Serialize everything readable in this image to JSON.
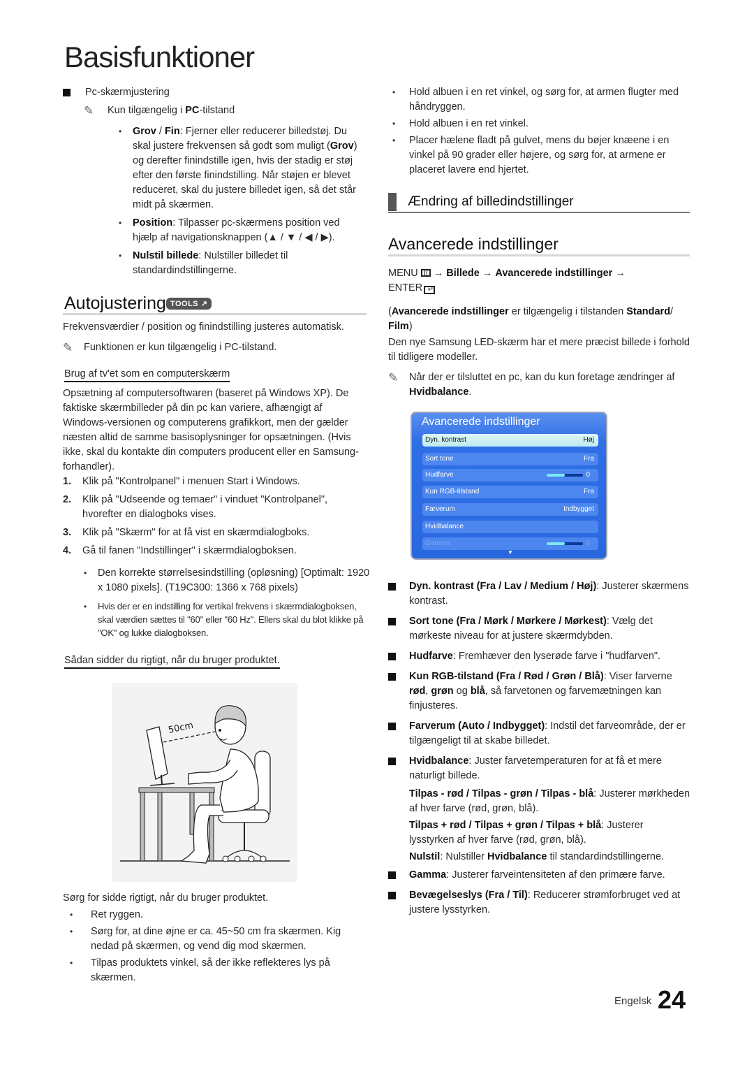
{
  "page": {
    "title": "Basisfunktioner",
    "language": "Engelsk",
    "page_number": "24"
  },
  "left": {
    "pc_adjust": {
      "heading": "Pc-skærmjustering",
      "note_prefix": "Kun tilgængelig i ",
      "note_bold": "PC",
      "note_suffix": "-tilstand",
      "bullets": [
        {
          "bold": "Grov",
          "sep": " / ",
          "bold2": "Fin",
          "text": ": Fjerner eller reducerer billedstøj. Du skal justere frekvensen så godt som muligt (",
          "bold3": "Grov",
          "text2": ") og derefter finindstille igen, hvis der stadig er støj efter den første finindstilling. Når støjen er blevet reduceret, skal du justere billedet igen, så det står midt på skærmen."
        },
        {
          "bold": "Position",
          "text": ": Tilpasser pc-skærmens position ved hjælp af navigationsknappen (▲ / ▼ / ◀ / ▶)."
        },
        {
          "bold": "Nulstil billede",
          "text": ": Nulstiller billedet til standardindstillingerne."
        }
      ]
    },
    "autojust": {
      "heading": "Autojustering",
      "badge": "TOOLS",
      "badge_icon": "↗",
      "desc": "Frekvensværdier / position og finindstilling justeres automatisk.",
      "note": "Funktionen er kun tilgængelig i PC-tilstand."
    },
    "computer": {
      "subheading": "Brug af tv'et som en computerskærm",
      "intro": "Opsætning af computersoftwaren (baseret på Windows XP). De faktiske skærmbilleder på din pc kan variere, afhængigt af Windows-versionen og computerens grafikkort, men der gælder næsten altid de samme basisoplysninger for opsætningen. (Hvis ikke, skal du kontakte din computers producent eller en Samsung-forhandler).",
      "steps": [
        {
          "num": "1.",
          "text": "Klik på \"Kontrolpanel\" i menuen Start i Windows."
        },
        {
          "num": "2.",
          "text": "Klik på \"Udseende og temaer\" i vinduet \"Kontrolpanel\", hvorefter en dialogboks vises."
        },
        {
          "num": "3.",
          "text": "Klik på \"Skærm\" for at få vist en skærmdialogboks."
        },
        {
          "num": "4.",
          "text": "Gå til fanen \"Indstillinger\" i skærmdialogboksen."
        }
      ],
      "sub_bullets": [
        "Den korrekte størrelsesindstilling (opløsning) [Optimalt: 1920 x 1080 pixels]. (T19C300: 1366 x 768 pixels)",
        "Hvis der er en indstilling for vertikal frekvens i skærmdialogboksen, skal værdien sættes til \"60\" eller \"60 Hz\". Ellers skal du blot klikke på \"OK\" og lukke dialogboksen."
      ]
    },
    "posture": {
      "subheading": "Sådan sidder du rigtigt, når du bruger produktet.",
      "illus_label": "50cm",
      "intro": "Sørg for sidde rigtigt, når du bruger produktet.",
      "bullets": [
        "Ret ryggen.",
        "Sørg for, at dine øjne er ca. 45~50 cm fra skærmen. Kig nedad på skærmen, og vend dig mod skærmen.",
        "Tilpas produktets vinkel, så der ikke reflekteres lys på skærmen."
      ]
    }
  },
  "right": {
    "posture_bullets": [
      "Hold albuen i en ret vinkel, og sørg for, at armen flugter med håndryggen.",
      "Hold albuen i en ret vinkel.",
      "Placer hælene fladt på gulvet, mens du bøjer knæene i en vinkel på 90 grader eller højere, og sørg for, at armene er placeret lavere end hjertet."
    ],
    "section_heading": "Ændring af billedindstillinger",
    "advanced": {
      "heading": "Avancerede indstillinger",
      "menu_path": {
        "menu": "MENU",
        "arrow": "→",
        "p1": "Billede",
        "p2": "Avancerede indstillinger",
        "enter": "ENTER"
      },
      "avail_bold": "Avancerede indstillinger",
      "avail_text": " er tilgængelig i tilstanden ",
      "avail_bold2": "Standard",
      "avail_sep": "/ ",
      "avail_bold3": "Film",
      "desc": "Den nye Samsung LED-skærm har et mere præcist billede i forhold til tidligere modeller.",
      "note_prefix": "Når der er tilsluttet en pc, kan du kun foretage ændringer af ",
      "note_bold": "Hvidbalance",
      "note_suffix": "."
    },
    "osd": {
      "title": "Avancerede indstillinger",
      "rows": [
        {
          "label": "Dyn. kontrast",
          "value": "Høj",
          "selected": true
        },
        {
          "label": "Sort tone",
          "value": "Fra"
        },
        {
          "label": "Hudfarve",
          "value": "0",
          "slider": 0.5
        },
        {
          "label": "Kun RGB-tilstand",
          "value": "Fra"
        },
        {
          "label": "Farverum",
          "value": "Indbygget"
        },
        {
          "label": "Hvidbalance",
          "value": ""
        },
        {
          "label": "Gamma",
          "value": "0",
          "slider": 0.5,
          "disabled": true
        }
      ],
      "more_arrow": "▼"
    },
    "items": [
      {
        "bold": "Dyn. kontrast (Fra / Lav / Medium / Høj)",
        "text": ": Justerer skærmens kontrast."
      },
      {
        "bold": "Sort tone (Fra / Mørk / Mørkere / Mørkest)",
        "text": ": Vælg det mørkeste niveau for at justere skærmdybden."
      },
      {
        "bold": "Hudfarve",
        "text": ": Fremhæver den lyserøde farve i \"hudfarven\"."
      },
      {
        "bold": "Kun RGB-tilstand (Fra / Rød / Grøn / Blå)",
        "text": ": Viser farverne ",
        "bold2": "rød",
        "t2": ", ",
        "bold3": "grøn",
        "t3": " og ",
        "bold4": "blå",
        "t4": ", så farvetonen og farvemætningen kan finjusteres."
      },
      {
        "bold": "Farverum (Auto / Indbygget)",
        "text": ": Indstil det farveområde, der er tilgængeligt til at skabe billedet."
      },
      {
        "bold": "Hvidbalance",
        "text": ": Juster farvetemperaturen for at få et mere naturligt billede."
      },
      {
        "bold": "Gamma",
        "text": ": Justerer farveintensiteten af den primære farve."
      },
      {
        "bold": "Bevægelseslys (Fra / Til)",
        "text": ": Reducerer strømforbruget ved at justere lysstyrken."
      }
    ],
    "whitebalance_sub": [
      {
        "bold": "Tilpas - rød / Tilpas - grøn / Tilpas - blå",
        "text": ": Justerer mørkheden af hver farve (rød, grøn, blå)."
      },
      {
        "bold": "Tilpas + rød / Tilpas + grøn / Tilpas + blå",
        "text": ": Justerer lysstyrken af hver farve (rød, grøn, blå)."
      },
      {
        "bold": "Nulstil",
        "text": ": Nulstiller ",
        "bold2": "Hvidbalance",
        "text2": " til standardindstillingerne."
      }
    ]
  }
}
